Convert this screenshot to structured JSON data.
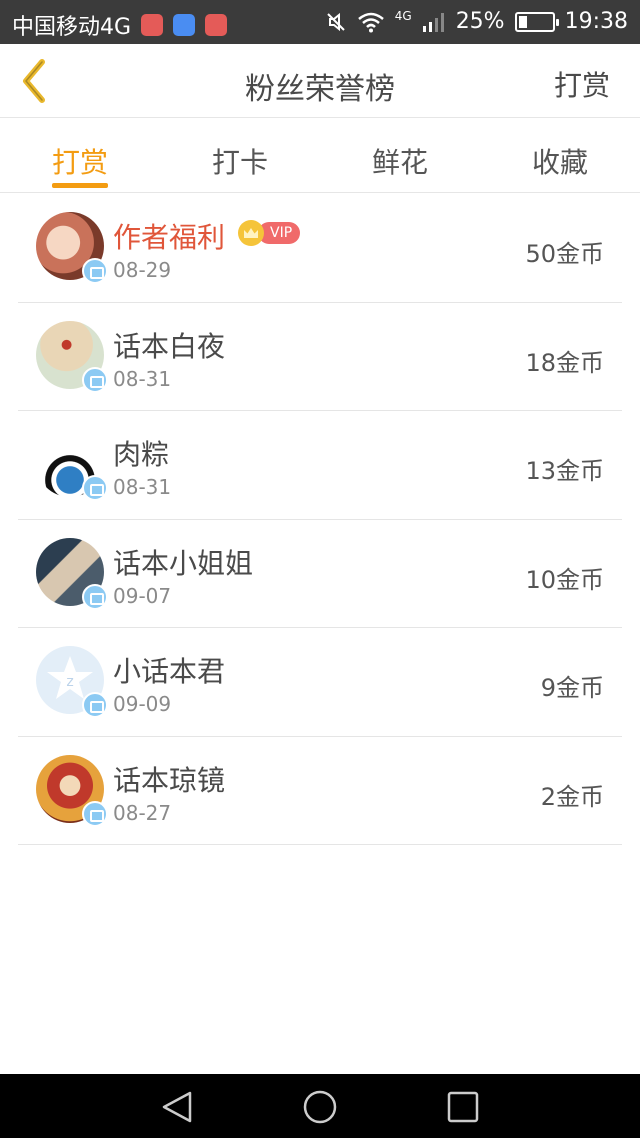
{
  "status_bar": {
    "carrier": "中国移动4G",
    "network": "4G",
    "battery_percent": "25%",
    "battery_level": 0.25,
    "time": "19:38"
  },
  "header": {
    "title": "粉丝荣誉榜",
    "right_button": "打赏"
  },
  "tabs": [
    {
      "label": "打赏",
      "active": true
    },
    {
      "label": "打卡",
      "active": false
    },
    {
      "label": "鲜花",
      "active": false
    },
    {
      "label": "收藏",
      "active": false
    }
  ],
  "rows": [
    {
      "name": "作者福利",
      "date": "08-29",
      "amount": "50金币",
      "vip": "VIP"
    },
    {
      "name": "话本白夜",
      "date": "08-31",
      "amount": "18金币"
    },
    {
      "name": "肉粽",
      "date": "08-31",
      "amount": "13金币"
    },
    {
      "name": "话本小姐姐",
      "date": "09-07",
      "amount": "10金币"
    },
    {
      "name": "小话本君",
      "date": "09-09",
      "amount": "9金币"
    },
    {
      "name": "话本琼镜",
      "date": "08-27",
      "amount": "2金币"
    }
  ],
  "colors": {
    "accent": "#f39c12",
    "vip_name": "#e0563a",
    "badge": "#8ccaf3"
  }
}
